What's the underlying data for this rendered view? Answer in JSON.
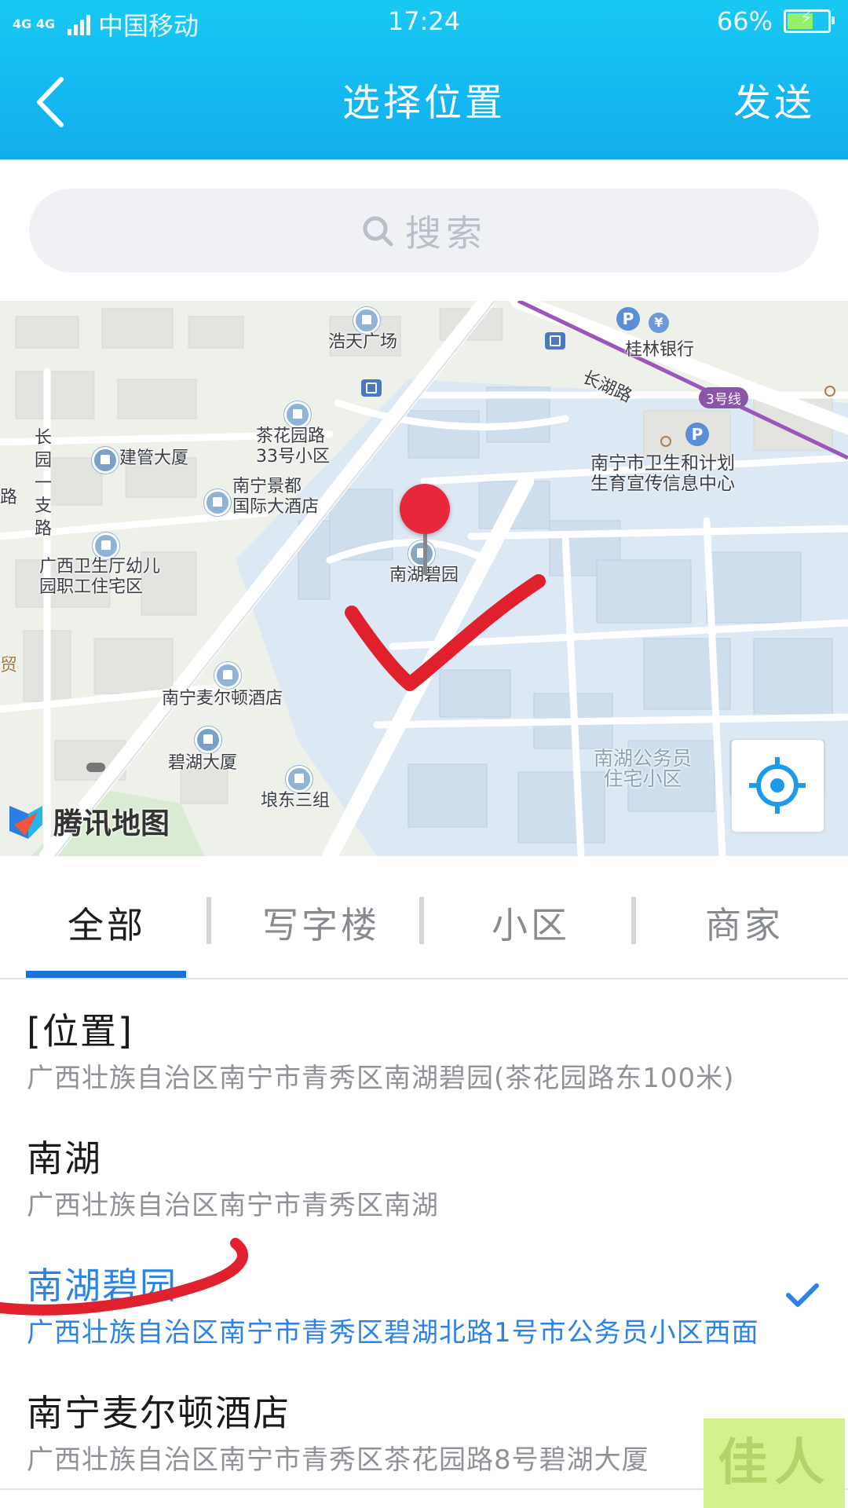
{
  "status_bar": {
    "network": "4G 4G",
    "carrier": "中国移动",
    "time": "17:24",
    "battery": "66%",
    "battery_level": 0.66
  },
  "header": {
    "back_icon": "chevron-left-icon",
    "title": "选择位置",
    "send_label": "发送"
  },
  "search": {
    "placeholder": "搜索",
    "icon": "search-icon"
  },
  "map": {
    "provider_logo_text": "腾讯地图",
    "labels": {
      "haotian": "浩天广场",
      "guilin_bank": "桂林银行",
      "changhu_road": "长湖路",
      "metro_line": "3号线",
      "chahuayuan": "茶花园路\n33号小区",
      "jianguan": "建管大厦",
      "changyuan": "长\n园\n一\n支\n路",
      "jingdu": "南宁景都\n国际大酒店",
      "weisheng": "南宁市卫生和计划\n生育宣传信息中心",
      "nanhubiyuan": "南湖碧园",
      "fuyou": "广西卫生厅幼儿\n园职工住宅区",
      "maerdun": "南宁麦尔顿酒店",
      "bihu": "碧湖大厦",
      "langdong": "埌东三组",
      "gongwuyuan": "南湖公务员\n住宅小区",
      "edge_lu": "路",
      "edge_mao": "贸"
    },
    "locate_icon": "crosshair-icon",
    "pin_color": "#e8283a",
    "annotation_color": "#e0202c"
  },
  "tabs": [
    {
      "label": "全部",
      "active": true
    },
    {
      "label": "写字楼",
      "active": false
    },
    {
      "label": "小区",
      "active": false
    },
    {
      "label": "商家",
      "active": false
    }
  ],
  "results": [
    {
      "name": "[位置]",
      "address": "广西壮族自治区南宁市青秀区南湖碧园(茶花园路东100米)",
      "selected": false
    },
    {
      "name": "南湖",
      "address": "广西壮族自治区南宁市青秀区南湖",
      "selected": false
    },
    {
      "name": "南湖碧园",
      "address": "广西壮族自治区南宁市青秀区碧湖北路1号市公务员小区西面",
      "selected": true
    },
    {
      "name": "南宁麦尔顿酒店",
      "address": "广西壮族自治区南宁市青秀区茶花园路8号碧湖大厦",
      "selected": false
    }
  ],
  "watermark": "佳人",
  "colors": {
    "header": "#14b8f0",
    "accent": "#1a74d8",
    "selected_text": "#2d83e3"
  }
}
